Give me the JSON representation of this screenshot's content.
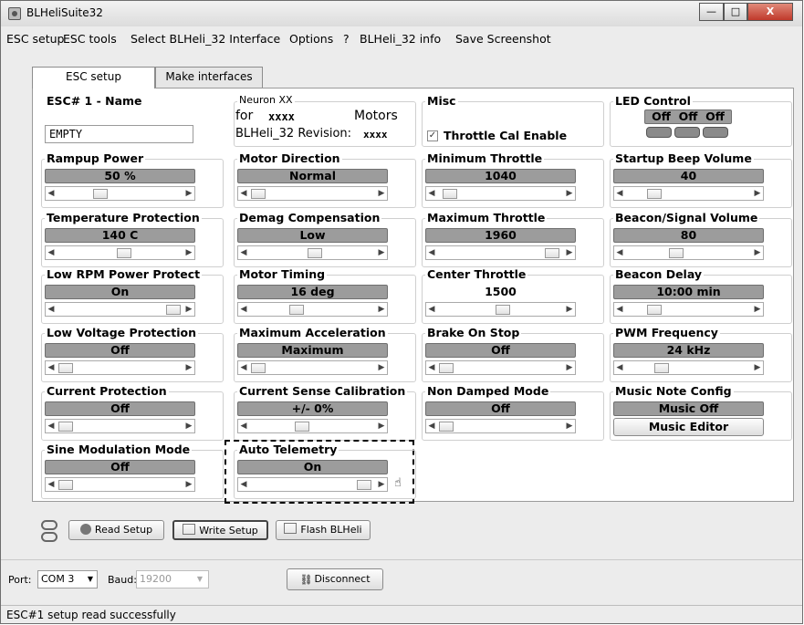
{
  "window": {
    "title": "BLHeliSuite32"
  },
  "menu": [
    "ESC setup",
    "ESC tools",
    "Select BLHeli_32 Interface",
    "Options",
    "?",
    "BLHeli_32 info",
    "Save Screenshot"
  ],
  "tabs": [
    "ESC setup",
    "Make interfaces"
  ],
  "esc_name": {
    "label": "ESC# 1 - Name",
    "value": "EMPTY"
  },
  "neuron": {
    "title": "Neuron XX",
    "line1_for": "for",
    "line1_x": "xxxx",
    "line1_motors": "Motors",
    "line2_label": "BLHeli_32 Revision:",
    "line2_value": "xxxx"
  },
  "misc": {
    "title": "Misc",
    "throttle_cal": "Throttle Cal Enable"
  },
  "led": {
    "title": "LED Control",
    "value": "Off  Off  Off"
  },
  "settings": {
    "rampup": {
      "title": "Rampup Power",
      "value": "50 %"
    },
    "motor_dir": {
      "title": "Motor Direction",
      "value": "Normal"
    },
    "min_throttle": {
      "title": "Minimum Throttle",
      "value": "1040"
    },
    "startup_beep": {
      "title": "Startup Beep Volume",
      "value": "40"
    },
    "temp_prot": {
      "title": "Temperature Protection",
      "value": "140 C"
    },
    "demag": {
      "title": "Demag Compensation",
      "value": "Low"
    },
    "max_throttle": {
      "title": "Maximum Throttle",
      "value": "1960"
    },
    "beacon_vol": {
      "title": "Beacon/Signal Volume",
      "value": "80"
    },
    "low_rpm": {
      "title": "Low RPM Power Protect",
      "value": "On"
    },
    "motor_timing": {
      "title": "Motor Timing",
      "value": "16 deg"
    },
    "center_throttle": {
      "title": "Center Throttle",
      "value": "1500"
    },
    "beacon_delay": {
      "title": "Beacon Delay",
      "value": "10:00 min"
    },
    "low_volt": {
      "title": "Low Voltage Protection",
      "value": "Off"
    },
    "max_accel": {
      "title": "Maximum Acceleration",
      "value": "Maximum"
    },
    "brake_stop": {
      "title": "Brake On Stop",
      "value": "Off"
    },
    "pwm_freq": {
      "title": "PWM Frequency",
      "value": "24 kHz"
    },
    "current_prot": {
      "title": "Current Protection",
      "value": "Off"
    },
    "current_sense": {
      "title": "Current Sense Calibration",
      "value": "+/- 0%"
    },
    "non_damped": {
      "title": "Non Damped Mode",
      "value": "Off"
    },
    "music_note": {
      "title": "Music Note Config",
      "value": "Music Off",
      "editor": "Music Editor"
    },
    "sine_mod": {
      "title": "Sine Modulation Mode",
      "value": "Off"
    },
    "auto_telemetry": {
      "title": "Auto Telemetry",
      "value": "On"
    }
  },
  "buttons": {
    "read": "Read Setup",
    "write": "Write Setup",
    "flash": "Flash BLHeli",
    "disconnect": "Disconnect"
  },
  "port": {
    "label": "Port:",
    "value": "COM 3",
    "baud_label": "Baud:",
    "baud_value": "19200"
  },
  "status": "ESC#1 setup read successfully"
}
